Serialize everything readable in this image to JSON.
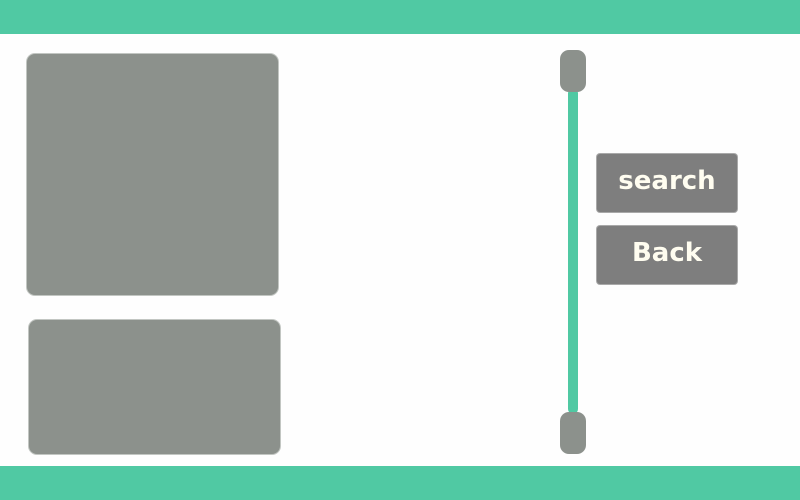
{
  "colors": {
    "accent": "#50c9a3",
    "panel": "#8c918c",
    "button": "#7e7e7e",
    "button_text": "#fffdf0",
    "background": "#fefefe"
  },
  "buttons": {
    "search_label": "search",
    "back_label": "Back"
  }
}
